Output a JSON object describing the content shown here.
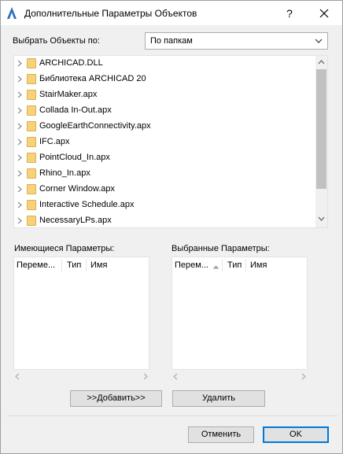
{
  "window": {
    "title": "Дополнительные Параметры Объектов",
    "help_label": "?"
  },
  "icons": {
    "app": "archicad-logo-icon",
    "close": "close-icon",
    "expand": "chevron-right-icon",
    "folder": "folder-icon"
  },
  "selector": {
    "label": "Выбрать Объекты по:",
    "value": "По папкам"
  },
  "tree": {
    "items": [
      "ARCHICAD.DLL",
      "Библиотека ARCHICAD 20",
      "StairMaker.apx",
      "Collada In-Out.apx",
      "GoogleEarthConnectivity.apx",
      "IFC.apx",
      "PointCloud_In.apx",
      "Rhino_In.apx",
      "Corner Window.apx",
      "Interactive Schedule.apx",
      "NecessaryLPs.apx"
    ]
  },
  "available": {
    "label": "Имеющиеся Параметры:",
    "columns": [
      "Переме...",
      "Тип",
      "Имя"
    ]
  },
  "selected": {
    "label": "Выбранные Параметры:",
    "columns": [
      "Перем...",
      "Тип",
      "Имя"
    ]
  },
  "buttons": {
    "add": ">>Добавить>>",
    "remove": "Удалить",
    "cancel": "Отменить",
    "ok": "OK"
  },
  "colors": {
    "accent": "#0078d7",
    "folder": "#f7d27a"
  }
}
